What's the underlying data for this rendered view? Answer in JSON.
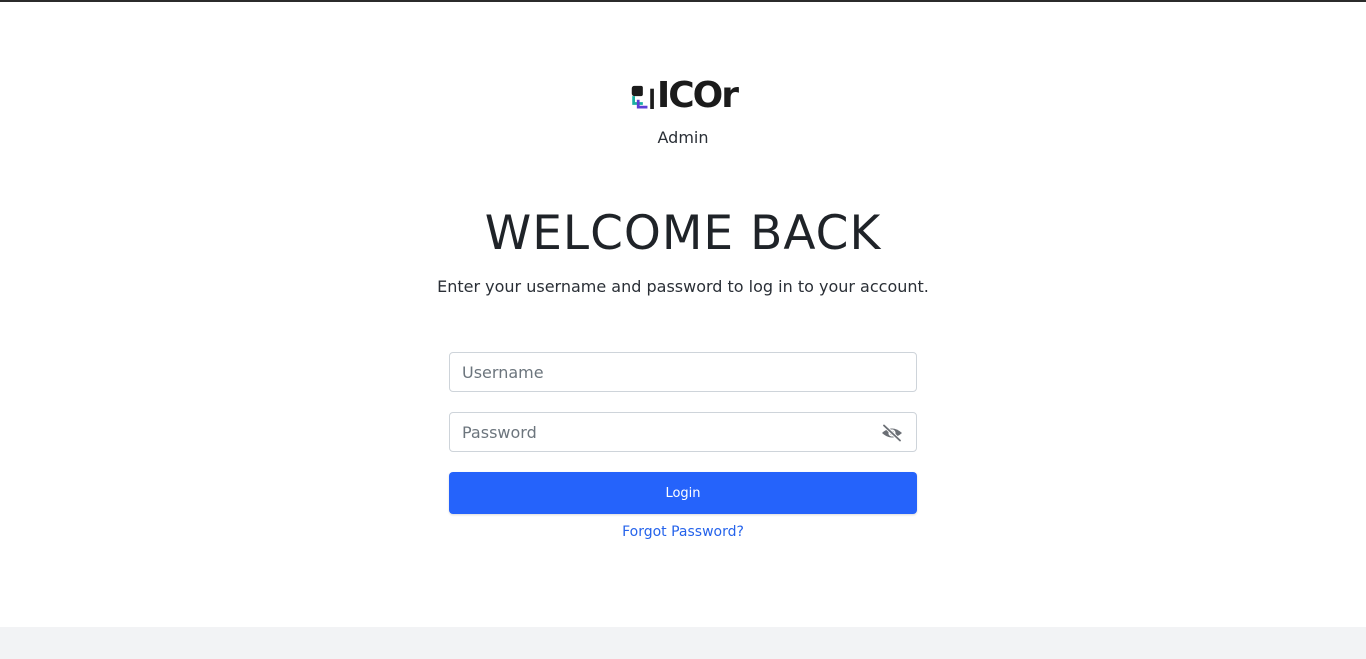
{
  "brand": {
    "logo_text": "ICOr",
    "subtitle": "Admin",
    "colors": {
      "logo_dark": "#1b1b1b",
      "logo_teal": "#1ab0a2",
      "logo_purple": "#5b3fd6"
    }
  },
  "login": {
    "title": "WELCOME BACK",
    "description": "Enter your username and password to log in to your account.",
    "username_placeholder": "Username",
    "username_value": "",
    "password_placeholder": "Password",
    "password_value": "",
    "password_toggle_icon": "eye-slash-icon",
    "login_label": "Login",
    "forgot_password_label": "Forgot Password?"
  },
  "theme": {
    "accent": "#2563fb",
    "link": "#2563eb",
    "footer_band": "#f2f3f5",
    "top_border": "#2b2b2b"
  }
}
